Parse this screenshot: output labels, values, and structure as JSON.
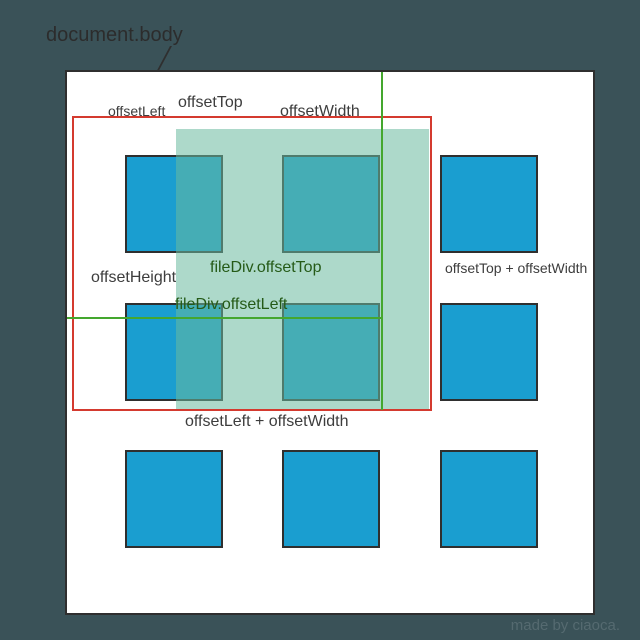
{
  "title": "document.body",
  "labels": {
    "offsetLeft": "offsetLeft",
    "offsetTop": "offsetTop",
    "offsetWidth": "offsetWidth",
    "offsetHeight": "offsetHeight",
    "fileDivOffsetTop": "fileDiv.offsetTop",
    "fileDivOffsetLeft": "fileDiv.offsetLeft",
    "offsetTopPlusWidth": "offsetTop + offsetWidth",
    "offsetLeftPlusWidth": "offsetLeft + offsetWidth"
  },
  "credit": "made by ciaoca.",
  "grid": {
    "cols": [
      60,
      217,
      375
    ],
    "rows": [
      85,
      233,
      380
    ]
  },
  "colors": {
    "square": "#1a9ed0",
    "redBox": "#d43a2f",
    "green": "#44a72e",
    "mint": "rgba(106,186,159,0.55)",
    "bg": "#3a5258"
  }
}
